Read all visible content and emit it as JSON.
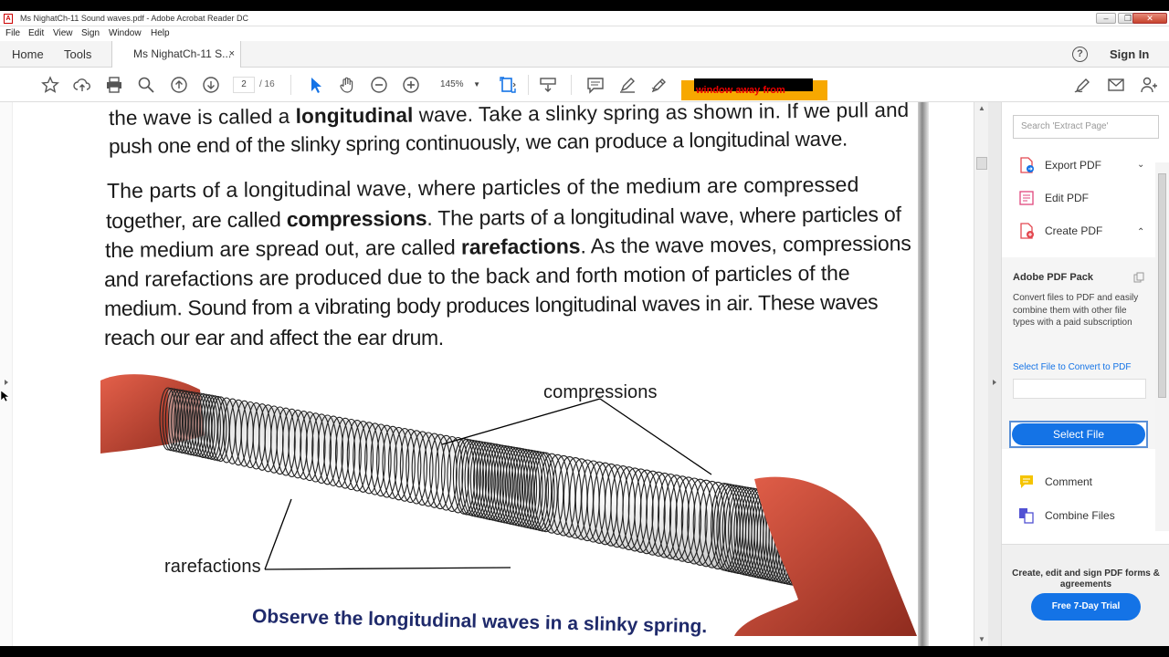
{
  "window": {
    "title": "Ms NighatCh-11 Sound waves.pdf - Adobe Acrobat Reader DC",
    "app_icon": "acrobat-icon"
  },
  "menu": [
    "File",
    "Edit",
    "View",
    "Sign",
    "Window",
    "Help"
  ],
  "tabs": {
    "home": "Home",
    "tools": "Tools",
    "document": "Ms NighatCh-11 S...",
    "close": "×",
    "help": "?",
    "sign_in": "Sign In"
  },
  "toolbar": {
    "page_current": "2",
    "page_total": "/ 16",
    "zoom": "145%",
    "zoom_caret": "▼",
    "overlay_text": "window away from"
  },
  "document": {
    "paragraph1": {
      "line1_pre": "the wave is called a ",
      "line1_bold": "longitudinal",
      "line1_post": " wave. Take a slinky spring as shown in. If we pull and",
      "line2": "push one end of the slinky spring continuously, we can produce a longitudinal wave."
    },
    "paragraph2": {
      "line1": "The parts of a longitudinal wave, where particles of the medium are compressed",
      "line2_pre": "together, are called ",
      "line2_bold": "compressions",
      "line2_post": ". The parts of a longitudinal wave, where particles of",
      "line3_pre": "the medium are spread out, are called ",
      "line3_bold": "rarefactions",
      "line3_post": ". As the wave moves, compressions",
      "line4": "and rarefactions are produced due to the back and forth motion of particles of the",
      "line5": "medium. Sound from a vibrating body produces longitudinal waves in air. These waves",
      "line6": "reach our ear and affect the ear drum."
    },
    "figure": {
      "label_compressions": "compressions",
      "label_rarefactions": "rarefactions",
      "caption": "Observe the longitudinal waves in a slinky spring."
    }
  },
  "right_pane": {
    "search_placeholder": "Search 'Extract Page'",
    "tools": [
      {
        "label": "Export PDF",
        "icon": "export-pdf-icon",
        "color": "#1473e6"
      },
      {
        "label": "Edit PDF",
        "icon": "edit-pdf-icon",
        "color": "#e0467c"
      },
      {
        "label": "Create PDF",
        "icon": "create-pdf-icon",
        "color": "#e34850"
      }
    ],
    "chevron_down": "⌄",
    "chevron_up": "⌃",
    "pack": {
      "heading": "Adobe PDF Pack",
      "description": "Convert files to PDF and easily combine them with other file types with a paid subscription",
      "link": "Select File to Convert to PDF",
      "button": "Select File"
    },
    "more_tools": [
      {
        "label": "Comment",
        "icon": "comment-icon",
        "color": "#f5c400"
      },
      {
        "label": "Combine Files",
        "icon": "combine-files-icon",
        "color": "#5151d3"
      }
    ],
    "promo": {
      "text": "Create, edit and sign PDF forms & agreements",
      "button": "Free 7-Day Trial"
    }
  }
}
